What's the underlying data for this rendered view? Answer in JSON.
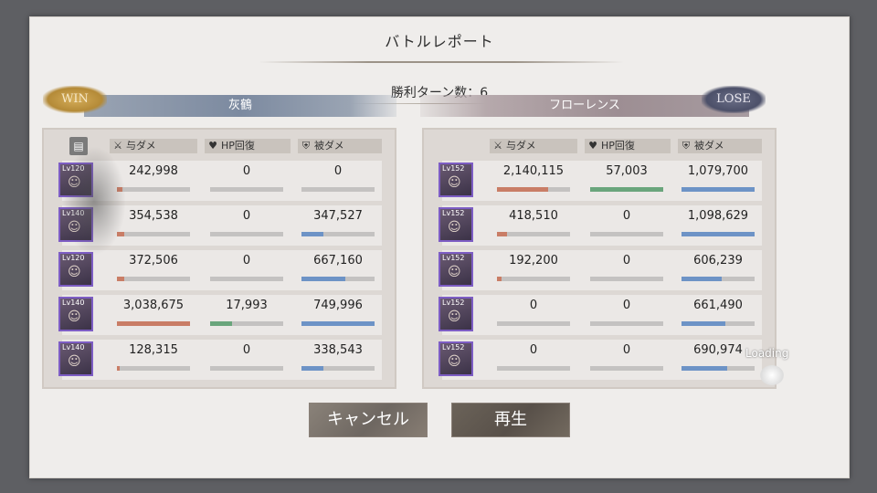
{
  "title": "バトルレポート",
  "turns_text": "勝利ターン数：6",
  "left": {
    "result": "WIN",
    "name": "灰鶴",
    "headers": {
      "damage": "与ダメ",
      "heal": "HP回復",
      "taken": "被ダメ"
    },
    "rows": [
      {
        "level": "Lv120",
        "damage": "242,998",
        "heal": "0",
        "taken": "0",
        "damage_frac": 0.07,
        "heal_frac": 0,
        "taken_frac": 0
      },
      {
        "level": "Lv140",
        "damage": "354,538",
        "heal": "0",
        "taken": "347,527",
        "damage_frac": 0.1,
        "heal_frac": 0,
        "taken_frac": 0.3
      },
      {
        "level": "Lv120",
        "damage": "372,506",
        "heal": "0",
        "taken": "667,160",
        "damage_frac": 0.1,
        "heal_frac": 0,
        "taken_frac": 0.6
      },
      {
        "level": "Lv140",
        "damage": "3,038,675",
        "heal": "17,993",
        "taken": "749,996",
        "damage_frac": 1.0,
        "heal_frac": 0.3,
        "taken_frac": 1.0
      },
      {
        "level": "Lv140",
        "damage": "128,315",
        "heal": "0",
        "taken": "338,543",
        "damage_frac": 0.04,
        "heal_frac": 0,
        "taken_frac": 0.3
      }
    ]
  },
  "right": {
    "result": "LOSE",
    "name": "フローレンス",
    "headers": {
      "damage": "与ダメ",
      "heal": "HP回復",
      "taken": "被ダメ"
    },
    "rows": [
      {
        "level": "Lv152",
        "damage": "2,140,115",
        "heal": "57,003",
        "taken": "1,079,700",
        "damage_frac": 0.7,
        "heal_frac": 1.0,
        "taken_frac": 1.0
      },
      {
        "level": "Lv152",
        "damage": "418,510",
        "heal": "0",
        "taken": "1,098,629",
        "damage_frac": 0.14,
        "heal_frac": 0,
        "taken_frac": 1.0
      },
      {
        "level": "Lv152",
        "damage": "192,200",
        "heal": "0",
        "taken": "606,239",
        "damage_frac": 0.06,
        "heal_frac": 0,
        "taken_frac": 0.55
      },
      {
        "level": "Lv152",
        "damage": "0",
        "heal": "0",
        "taken": "661,490",
        "damage_frac": 0,
        "heal_frac": 0,
        "taken_frac": 0.6
      },
      {
        "level": "Lv152",
        "damage": "0",
        "heal": "0",
        "taken": "690,974",
        "damage_frac": 0,
        "heal_frac": 0,
        "taken_frac": 0.63
      }
    ]
  },
  "buttons": {
    "cancel": "キャンセル",
    "play": "再生"
  },
  "loading": "Loading",
  "colors": {
    "damage": "#c97d66",
    "heal": "#6aa57c",
    "taken": "#6d93c6"
  }
}
